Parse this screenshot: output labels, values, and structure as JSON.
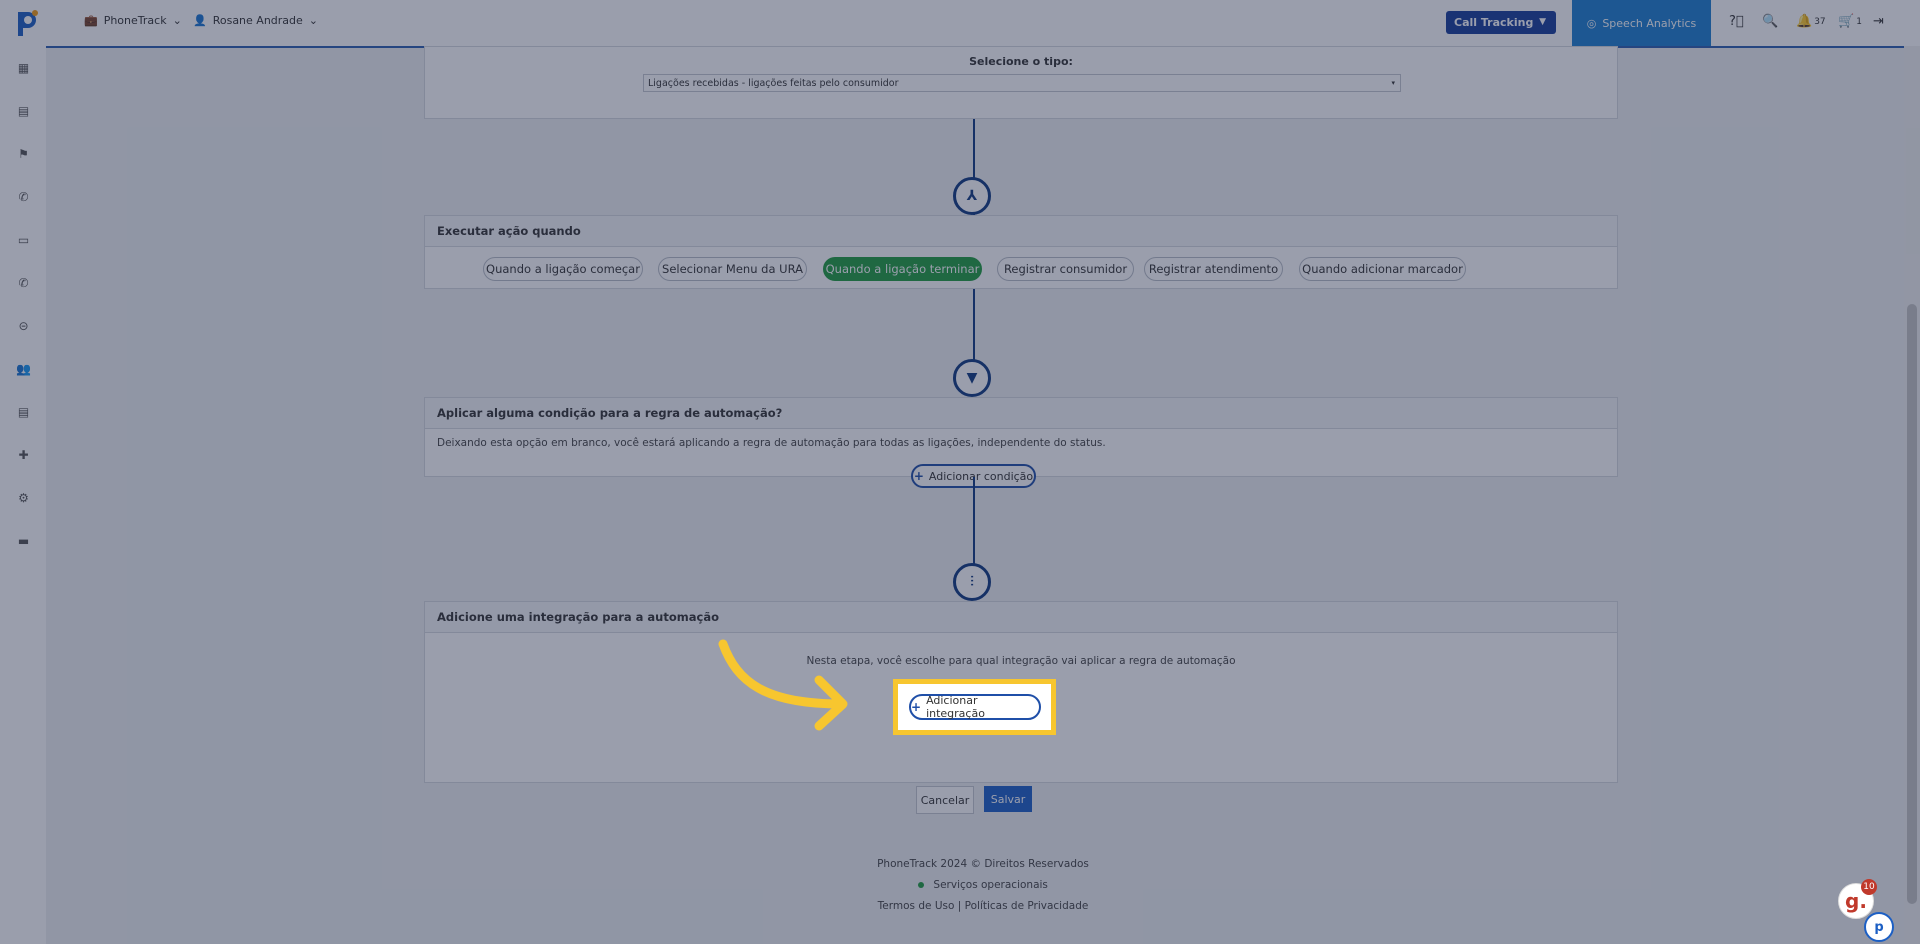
{
  "topbar": {
    "company_menu": "PhoneTrack",
    "user_menu": "Rosane Andrade",
    "call_tracking_label": "Call Tracking",
    "speech_analytics_label": "Speech Analytics",
    "notifications_count": "37",
    "cart_count": "1"
  },
  "type_card": {
    "label": "Selecione o tipo:",
    "select_value": "Ligações recebidas - ligações feitas pelo consumidor"
  },
  "action_card": {
    "title": "Executar ação quando",
    "options": [
      {
        "label": "Quando a ligação começar",
        "active": false
      },
      {
        "label": "Selecionar Menu da URA",
        "active": false
      },
      {
        "label": "Quando a ligação terminar",
        "active": true
      },
      {
        "label": "Registrar consumidor",
        "active": false
      },
      {
        "label": "Registrar atendimento",
        "active": false
      },
      {
        "label": "Quando adicionar marcador",
        "active": false
      }
    ]
  },
  "condition_card": {
    "title": "Aplicar alguma condição para a regra de automação?",
    "description": "Deixando esta opção em branco, você estará aplicando a regra de automação para todas as ligações, independente do status.",
    "add_button": "Adicionar condição"
  },
  "integration_card": {
    "title": "Adicione uma integração para a automação",
    "description": "Nesta etapa, você escolhe para qual integração vai aplicar a regra de automação",
    "add_button": "Adicionar integração"
  },
  "actions": {
    "cancel": "Cancelar",
    "save": "Salvar"
  },
  "footer": {
    "copyright": "PhoneTrack 2024 © Direitos Reservados",
    "status": "Serviços operacionais",
    "terms": "Termos de Uso",
    "separator": "|",
    "privacy": "Políticas de Privacidade"
  },
  "chat_badge": "10",
  "colors": {
    "primary": "#173d9a",
    "active_pill": "#1f9d3e",
    "highlight": "#f7c62f",
    "speech_analytics": "#1c7fd0"
  }
}
